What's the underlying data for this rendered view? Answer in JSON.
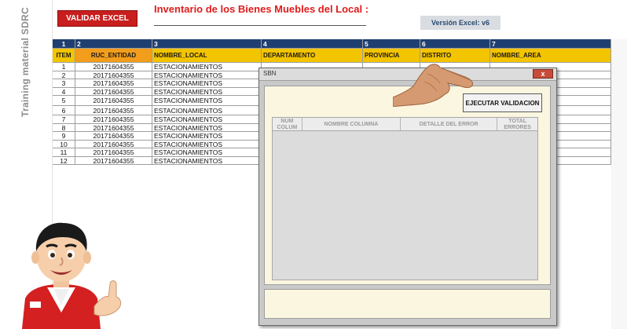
{
  "side_label": "Training material SDRC",
  "header": {
    "validate_button": "VALIDAR EXCEL",
    "title": "Inventario de los Bienes Muebles del Local :",
    "version": "Versión Excel: v6"
  },
  "sheet": {
    "column_numbers": [
      "1",
      "2",
      "3",
      "4",
      "5",
      "6",
      "7"
    ],
    "headers": [
      "ITEM",
      "RUC_ENTIDAD",
      "NOMBRE_LOCAL",
      "DEPARTAMENTO",
      "PROVINCIA",
      "DISTRITO",
      "NOMBRE_AREA"
    ],
    "rows": [
      [
        "1",
        "20171604355",
        "ESTACIONAMIENTOS"
      ],
      [
        "2",
        "20171604355",
        "ESTACIONAMIENTOS"
      ],
      [
        "3",
        "20171604355",
        "ESTACIONAMIENTOS"
      ],
      [
        "4",
        "20171604355",
        "ESTACIONAMIENTOS"
      ],
      [
        "5",
        "20171604355",
        "ESTACIONAMIENTOS"
      ],
      [
        "6",
        "20171604355",
        "ESTACIONAMIENTOS"
      ],
      [
        "7",
        "20171604355",
        "ESTACIONAMIENTOS"
      ],
      [
        "8",
        "20171604355",
        "ESTACIONAMIENTOS"
      ],
      [
        "9",
        "20171604355",
        "ESTACIONAMIENTOS"
      ],
      [
        "10",
        "20171604355",
        "ESTACIONAMIENTOS"
      ],
      [
        "11",
        "20171604355",
        "ESTACIONAMIENTOS"
      ],
      [
        "12",
        "20171604355",
        "ESTACIONAMIENTOS"
      ]
    ]
  },
  "dialog": {
    "title": "SBN",
    "close_label": "x",
    "execute_button": "EJECUTAR VALIDACION",
    "columns": [
      "NUM COLUM",
      "NOMBRE COLUMNA",
      "DETALLE DEL ERROR",
      "TOTAL ERRORES"
    ]
  },
  "colors": {
    "header_bar": "#1f3f70",
    "header_yellow": "#f3c400",
    "header_orange": "#f29d1c",
    "validate_red": "#c81e1e",
    "title_red": "#e01b1b",
    "dialog_panel": "#fbf6df"
  },
  "icons": {
    "pointer": "hand-pointer-icon",
    "mascot": "mascot-character"
  }
}
